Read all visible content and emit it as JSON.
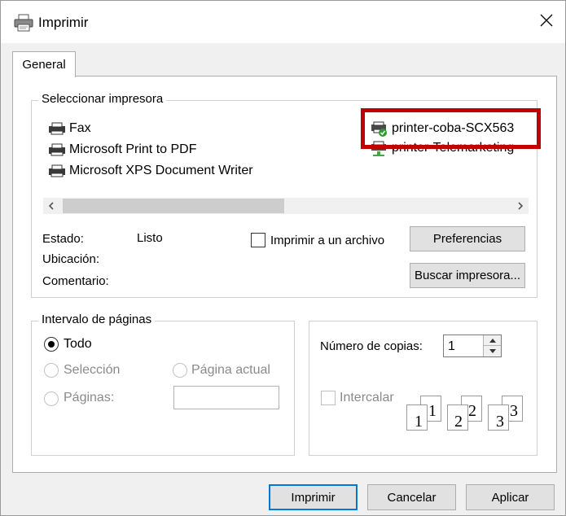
{
  "window": {
    "title": "Imprimir"
  },
  "tabs": [
    {
      "label": "General"
    }
  ],
  "select_printer": {
    "group_label": "Seleccionar impresora",
    "printers": [
      {
        "name": "Fax",
        "icon": "fax-printer-icon"
      },
      {
        "name": "Microsoft Print to PDF",
        "icon": "printer-icon"
      },
      {
        "name": "Microsoft XPS Document Writer",
        "icon": "printer-icon"
      },
      {
        "name": "printer-coba-SCX563",
        "icon": "network-printer-default-icon",
        "selected": true
      },
      {
        "name": "printer-Telemarketing",
        "icon": "network-printer-icon"
      }
    ],
    "status_label": "Estado:",
    "status_value": "Listo",
    "location_label": "Ubicación:",
    "comment_label": "Comentario:",
    "print_to_file_label": "Imprimir a un archivo",
    "preferences_button": "Preferencias",
    "find_printer_button": "Buscar impresora..."
  },
  "page_range": {
    "group_label": "Intervalo de páginas",
    "all_label": "Todo",
    "selection_label": "Selección",
    "current_page_label": "Página actual",
    "pages_label": "Páginas:",
    "pages_value": "",
    "selected": "Todo"
  },
  "copies": {
    "label": "Número de copias:",
    "value": "1",
    "collate_label": "Intercalar",
    "collate_icon_numbers": [
      "1",
      "1",
      "2",
      "2",
      "3",
      "3"
    ]
  },
  "footer": {
    "print_button": "Imprimir",
    "cancel_button": "Cancelar",
    "apply_button": "Aplicar"
  },
  "colors": {
    "highlight": "#c00000",
    "focus": "#0078d7"
  }
}
